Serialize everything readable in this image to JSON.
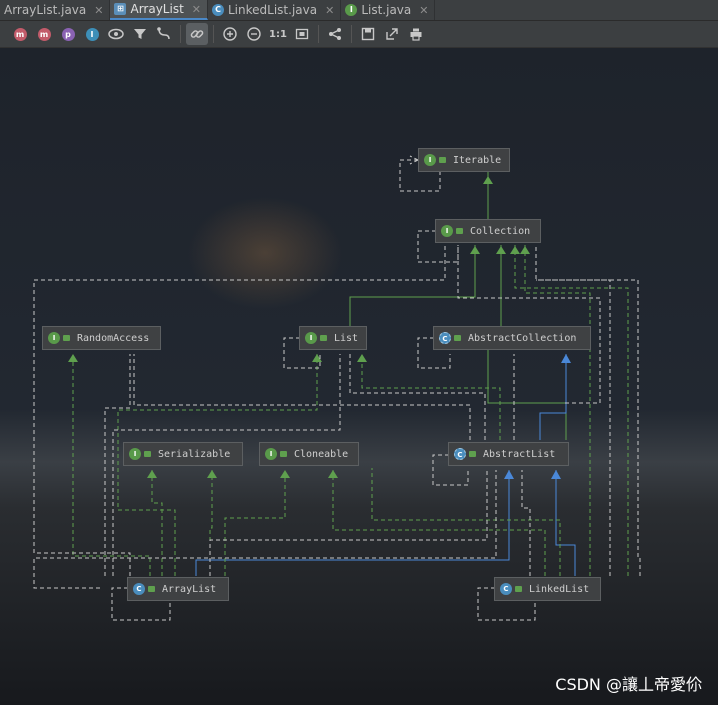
{
  "tabs": [
    {
      "label": "ArrayList.java",
      "icon": "class-file-icon",
      "active": false
    },
    {
      "label": "ArrayList",
      "icon": "diagram-icon",
      "active": true
    },
    {
      "label": "LinkedList.java",
      "icon": "class-icon",
      "active": false
    },
    {
      "label": "List.java",
      "icon": "interface-icon",
      "active": false
    }
  ],
  "toolbar": {
    "fields_label": "m",
    "methods_label": "m",
    "properties_label": "p",
    "inner_label": "I",
    "actual_size_label": "1:1"
  },
  "nodes": {
    "iterable": {
      "label": "Iterable",
      "kind": "interface"
    },
    "collection": {
      "label": "Collection",
      "kind": "interface"
    },
    "random_access": {
      "label": "RandomAccess",
      "kind": "interface"
    },
    "list": {
      "label": "List",
      "kind": "interface"
    },
    "abstract_collection": {
      "label": "AbstractCollection",
      "kind": "abstract"
    },
    "serializable": {
      "label": "Serializable",
      "kind": "interface"
    },
    "cloneable": {
      "label": "Cloneable",
      "kind": "interface"
    },
    "abstract_list": {
      "label": "AbstractList",
      "kind": "abstract"
    },
    "array_list": {
      "label": "ArrayList",
      "kind": "class"
    },
    "linked_list": {
      "label": "LinkedList",
      "kind": "class"
    }
  },
  "node_icon_letters": {
    "interface": "I",
    "class": "C",
    "abstract": "C"
  },
  "colors": {
    "implements_arrow": "#5fa04e",
    "extends_arrow": "#4a88d8",
    "dependency_dashed": "#c8c8c8"
  },
  "watermark": "CSDN @讓丄帝愛伱"
}
